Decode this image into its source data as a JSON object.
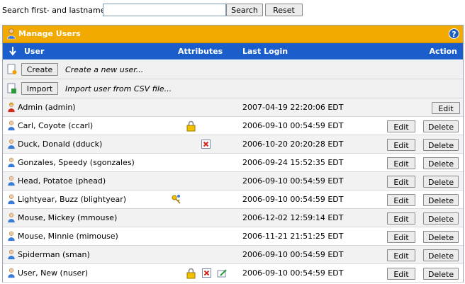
{
  "search": {
    "label": "Search first- and lastnames:",
    "value": "",
    "search_button": "Search",
    "reset_button": "Reset"
  },
  "panel": {
    "title": "Manage Users",
    "help_glyph": "?",
    "columns": {
      "user": "User",
      "attributes": "Attributes",
      "last_login": "Last Login",
      "action": "Action"
    },
    "create": {
      "button": "Create",
      "description": "Create a new user..."
    },
    "import": {
      "button": "Import",
      "description": "Import user from CSV file..."
    }
  },
  "labels": {
    "edit": "Edit",
    "delete": "Delete"
  },
  "colors": {
    "title_bar": "#f2a900",
    "header": "#1c5dcc"
  },
  "users": [
    {
      "name": "Admin (admin)",
      "last_login": "2007-04-19 22:20:06 EDT",
      "icon": "admin-user-icon",
      "attributes": [],
      "can_delete": false
    },
    {
      "name": "Carl, Coyote (ccarl)",
      "last_login": "2006-09-10 00:54:59 EDT",
      "icon": "user-icon",
      "attributes": [
        "locked-icon"
      ],
      "can_delete": true
    },
    {
      "name": "Duck, Donald (dduck)",
      "last_login": "2006-10-20 20:20:28 EDT",
      "icon": "user-icon",
      "attributes": [
        "disabled-icon"
      ],
      "can_delete": true
    },
    {
      "name": "Gonzales, Speedy (sgonzales)",
      "last_login": "2006-09-24 15:52:35 EDT",
      "icon": "user-icon",
      "attributes": [],
      "can_delete": true
    },
    {
      "name": "Head, Potatoe (phead)",
      "last_login": "2006-09-10 00:54:59 EDT",
      "icon": "user-icon",
      "attributes": [],
      "can_delete": true
    },
    {
      "name": "Lightyear, Buzz (blightyear)",
      "last_login": "2006-09-10 00:54:59 EDT",
      "icon": "user-icon",
      "attributes": [
        "key-icon"
      ],
      "can_delete": true
    },
    {
      "name": "Mouse, Mickey (mmouse)",
      "last_login": "2006-12-02 12:59:14 EDT",
      "icon": "user-icon",
      "attributes": [],
      "can_delete": true
    },
    {
      "name": "Mouse, Minnie (mimouse)",
      "last_login": "2006-11-21 21:51:25 EDT",
      "icon": "user-icon",
      "attributes": [],
      "can_delete": true
    },
    {
      "name": "Spiderman (sman)",
      "last_login": "2006-09-10 00:54:59 EDT",
      "icon": "user-icon",
      "attributes": [],
      "can_delete": true
    },
    {
      "name": "User, New (nuser)",
      "last_login": "2006-09-10 00:54:59 EDT",
      "icon": "user-icon",
      "attributes": [
        "locked-icon",
        "disabled-icon",
        "edit-note-icon"
      ],
      "can_delete": true
    }
  ]
}
